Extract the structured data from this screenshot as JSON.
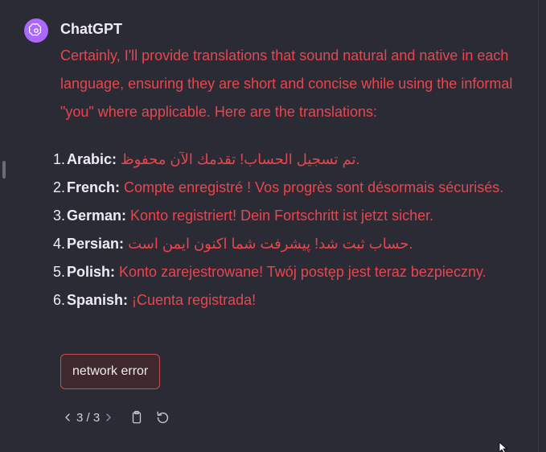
{
  "message": {
    "author": "ChatGPT",
    "intro": "Certainly, I'll provide translations that sound natural and native in each language, ensuring they are short and concise while using the informal \"you\" where applicable. Here are the translations:",
    "translations": [
      {
        "num": "1.",
        "lang": "Arabic:",
        "text": "تم تسجيل الحساب! تقدمك الآن محفوظ."
      },
      {
        "num": "2.",
        "lang": "French:",
        "text": "Compte enregistré ! Vos progrès sont désormais sécurisés."
      },
      {
        "num": "3.",
        "lang": "German:",
        "text": "Konto registriert! Dein Fortschritt ist jetzt sicher."
      },
      {
        "num": "4.",
        "lang": "Persian:",
        "text": "حساب ثبت شد! پیشرفت شما اکنون ایمن است."
      },
      {
        "num": "5.",
        "lang": "Polish:",
        "text": "Konto zarejestrowane! Twój postęp jest teraz bezpieczny."
      },
      {
        "num": "6.",
        "lang": "Spanish:",
        "text": "¡Cuenta registrada!"
      }
    ],
    "error": "network error"
  },
  "toolbar": {
    "pager": "3 / 3",
    "icons": [
      "chevron-left-icon",
      "chevron-right-icon",
      "clipboard-icon",
      "regenerate-icon"
    ]
  },
  "colors": {
    "background": "#2b2b35",
    "error_text": "#e8464e",
    "avatar": "#ab68ff"
  }
}
